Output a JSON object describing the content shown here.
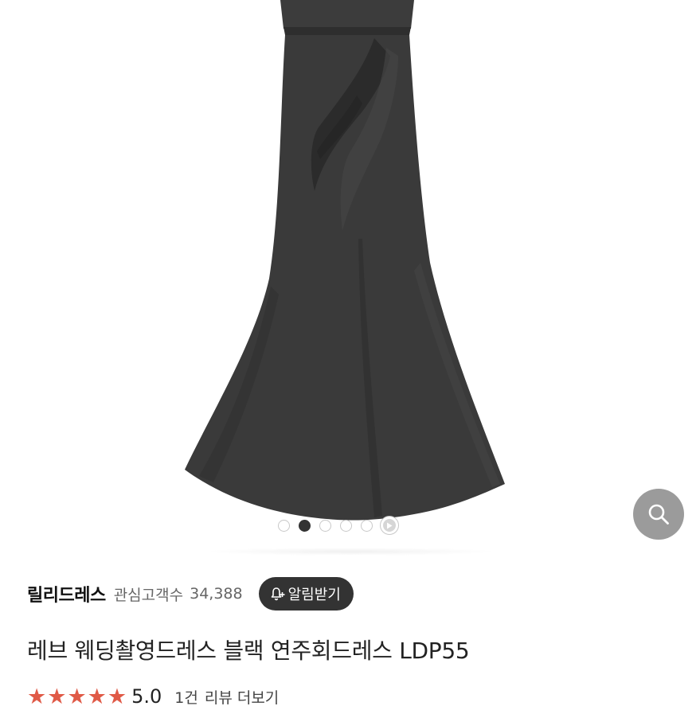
{
  "gallery": {
    "image": "black mermaid dress product photo",
    "dress_color": "#3a3a3a",
    "indicator": {
      "total": 5,
      "active_index": 1,
      "has_video": true
    }
  },
  "search_button": {
    "icon": "search-icon"
  },
  "seller": {
    "name": "릴리드레스",
    "fans_label": "관심고객수",
    "fans_count": "34,388",
    "alert_button_label": "알림받기",
    "alert_icon": "bell-plus-icon"
  },
  "product": {
    "title": "레브 웨딩촬영드레스 블랙 연주회드레스 LDP55"
  },
  "rating": {
    "score": "5.0",
    "stars": 5,
    "review_count": "1건",
    "review_more": "리뷰 더보기",
    "star_color": "#e05a47"
  }
}
